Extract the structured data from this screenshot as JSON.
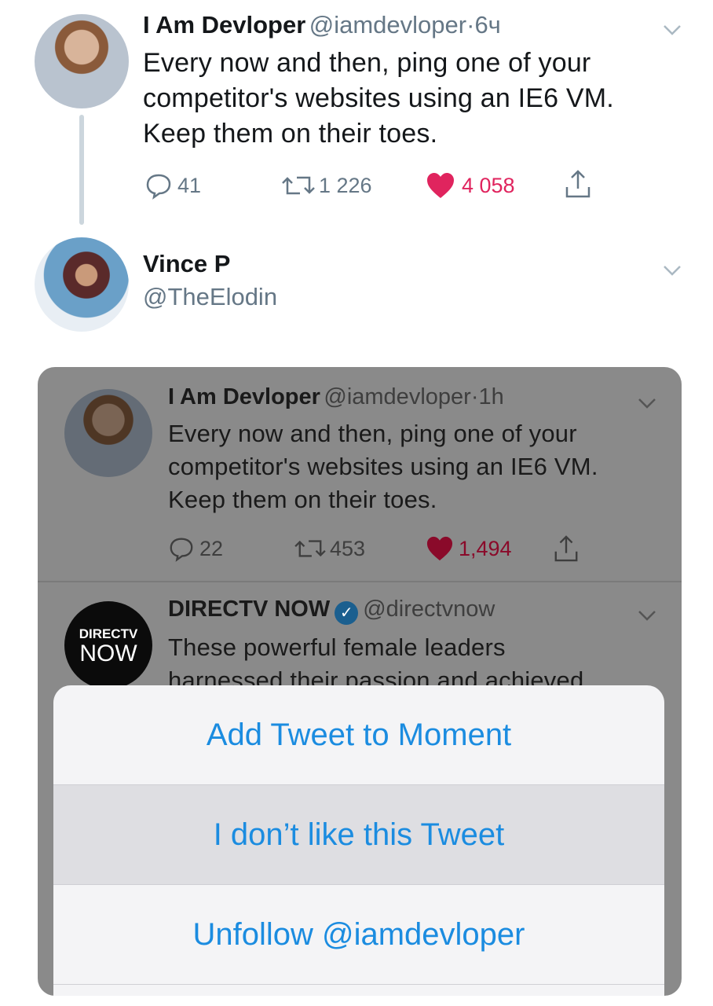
{
  "tweet1": {
    "name": "I Am Devloper",
    "handle": "@iamdevloper",
    "separator": "·",
    "time": "6ч",
    "text_lines": [
      "Every now and then, ping one of your",
      "competitor's websites using an IE6 VM.",
      "Keep them on their toes."
    ],
    "replies": "41",
    "retweets": "1 226",
    "likes": "4 058",
    "icons": {
      "reply": "reply-icon",
      "retweet": "retweet-icon",
      "like": "heart-icon",
      "share": "share-icon",
      "menu": "chevron-down-icon"
    }
  },
  "reply": {
    "name": "Vince P",
    "handle": "@TheElodin"
  },
  "quoted": {
    "name": "I Am Devloper",
    "handle": "@iamdevloper",
    "separator": "·",
    "time": "1h",
    "text_lines": [
      "Every now and then, ping one of your",
      "competitor's websites using an IE6 VM.",
      "Keep them on their toes."
    ],
    "replies": "22",
    "retweets": "453",
    "likes": "1,494"
  },
  "quoted2": {
    "name": "DIRECTV NOW",
    "handle": "@directvnow",
    "logo_line1": "DIRECTV",
    "logo_line2": "NOW",
    "text_lines": [
      "These powerful female leaders",
      "harnessed their passion and achieved"
    ]
  },
  "action_sheet": {
    "items": [
      "Add Tweet to Moment",
      "I don’t like this Tweet",
      "Unfollow @iamdevloper"
    ]
  },
  "colors": {
    "link_blue": "#1b8ce0",
    "like_red": "#e0245e",
    "muted": "#657786"
  }
}
